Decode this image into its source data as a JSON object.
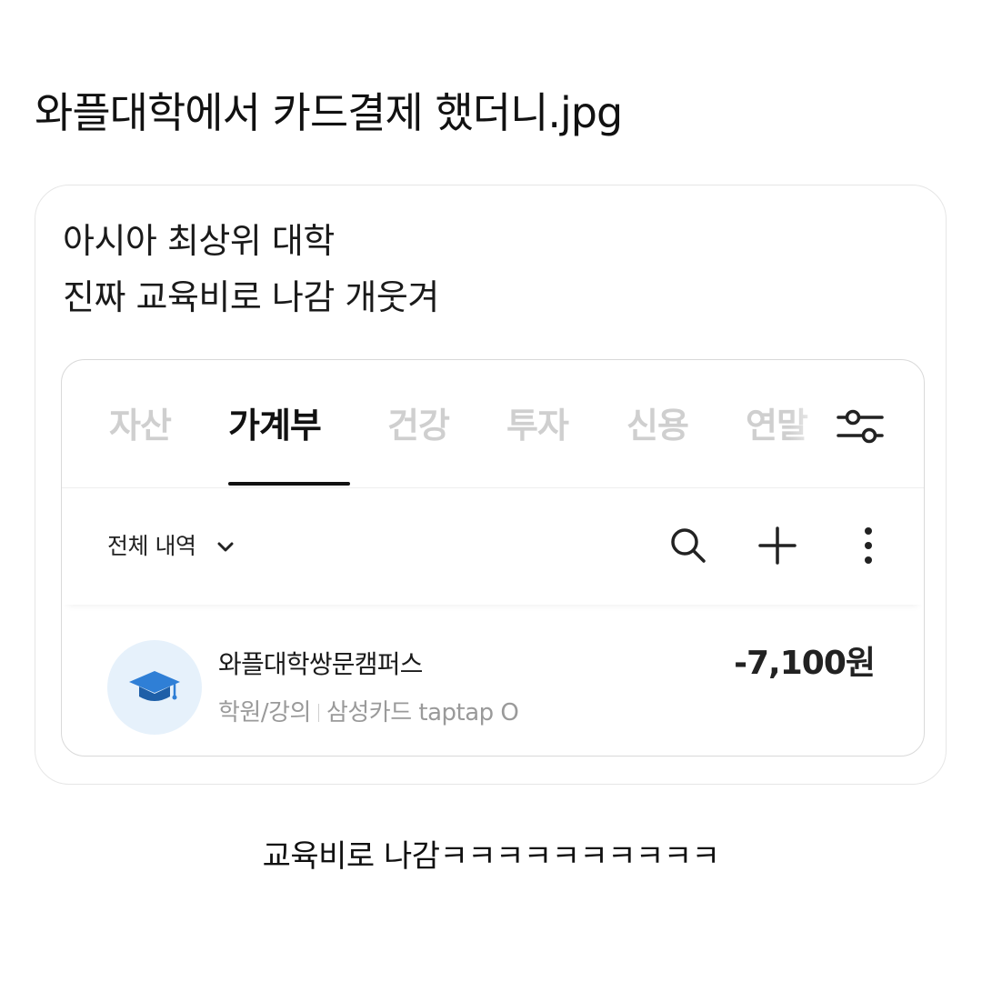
{
  "page": {
    "title": "와플대학에서 카드결제 했더니.jpg",
    "caption": "교육비로 나감ㅋㅋㅋㅋㅋㅋㅋㅋㅋㅋ"
  },
  "post": {
    "line1": "아시아 최상위 대학",
    "line2": "진짜 교육비로 나감 개웃겨"
  },
  "app": {
    "tabs": [
      {
        "label": "자산",
        "active": false
      },
      {
        "label": "가계부",
        "active": true
      },
      {
        "label": "건강",
        "active": false
      },
      {
        "label": "투자",
        "active": false
      },
      {
        "label": "신용",
        "active": false
      },
      {
        "label": "연말",
        "active": false
      }
    ],
    "filter_icon": "sliders-icon",
    "toolbar": {
      "dropdown_label": "전체 내역",
      "icons": [
        "search-icon",
        "plus-icon",
        "more-vertical-icon"
      ]
    },
    "transaction": {
      "icon": "graduation-cap-icon",
      "merchant": "와플대학쌍문캠퍼스",
      "category": "학원/강의",
      "card": "삼성카드 taptap O",
      "amount": "-7,100원"
    }
  },
  "colors": {
    "active_tab": "#111111",
    "inactive_tab": "#cfcfcf",
    "avatar_bg": "#e6f1fb",
    "cap_icon": "#2f7fd6",
    "meta_text": "#9a9a9a"
  }
}
